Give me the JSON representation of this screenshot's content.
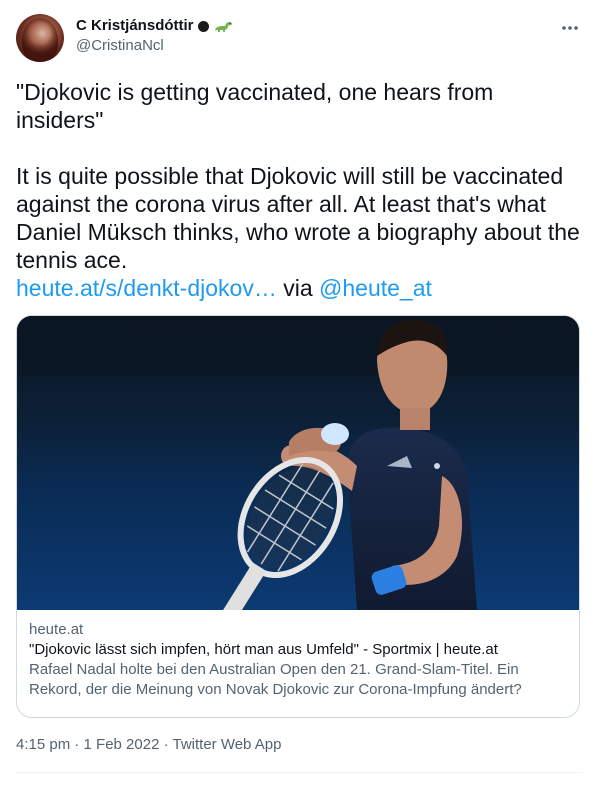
{
  "author": {
    "display_name": "C Kristjánsdóttir",
    "handle": "@CristinaNcl"
  },
  "tweet": {
    "quote": "\"Djokovic is getting vaccinated, one hears from insiders\"",
    "body": "It is quite possible that Djokovic will still be vaccinated against the corona virus after all. At least that's what Daniel Müksch thinks, who wrote a biography about the tennis ace.",
    "link_text": "heute.at/s/denkt-djokov…",
    "via_text": " via ",
    "mention": "@heute_at"
  },
  "card": {
    "domain": "heute.at",
    "title": "\"Djokovic lässt sich impfen, hört man aus Umfeld\" - Sportmix | heute.at",
    "description": "Rafael Nadal holte bei den Australian Open den 21. Grand-Slam-Titel. Ein Rekord, der die Meinung von Novak Djokovic zur Corona-Impfung ändert?"
  },
  "meta": {
    "timestamp": "4:15 pm · 1 Feb 2022 · Twitter Web App"
  },
  "colors": {
    "link": "#1d9bf0",
    "text": "#0f1419",
    "secondary": "#536471",
    "border": "#cfd9de"
  },
  "icons": {
    "more": "more-options-icon",
    "emoji_1": "black-circle-icon",
    "emoji_2": "dinosaur-icon"
  }
}
